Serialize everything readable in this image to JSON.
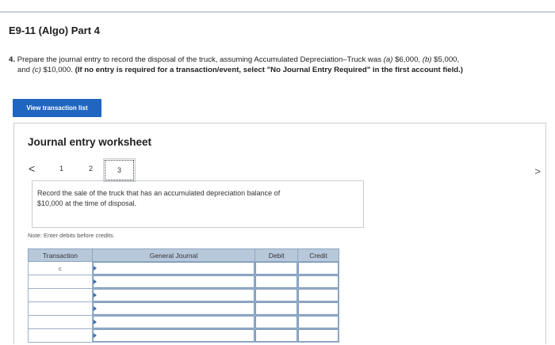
{
  "header": {
    "title": "E9-11 (Algo) Part 4"
  },
  "question": {
    "number": "4.",
    "line1_text": "Prepare the journal entry to record the disposal of the truck, assuming Accumulated Depreciation–Truck was ",
    "a_label": "(a)",
    "a_value": " $6,000, ",
    "b_label": "(b)",
    "b_value": " $5,000,",
    "line2_prefix": "and ",
    "c_label": "(c)",
    "c_value": " $10,000. ",
    "instruction_bold": "(If no entry is required for a transaction/event, select \"No Journal Entry Required\" in the first account field.)"
  },
  "view_transaction_button": "View transaction list",
  "worksheet": {
    "title": "Journal entry worksheet",
    "prev_glyph": "<",
    "next_glyph": ">",
    "pages": [
      "1",
      "2",
      "3"
    ],
    "instruction_line1": "Record the sale of the truck that has an accumulated depreciation balance of",
    "instruction_line2": "$10,000 at the time of disposal.",
    "note": "Note: Enter debits before credits.",
    "table": {
      "headers": {
        "transaction": "Transaction",
        "general_journal": "General Journal",
        "debit": "Debit",
        "credit": "Credit"
      },
      "first_transaction": "c"
    }
  }
}
